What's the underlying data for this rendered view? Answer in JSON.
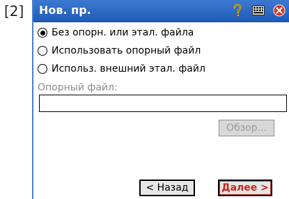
{
  "step_tag": "[2]",
  "window": {
    "title": "Нов. пр.",
    "icons": [
      "help-icon",
      "keyboard-icon",
      "close-icon"
    ]
  },
  "options": [
    {
      "label": "Без опорн. или этал. файла",
      "selected": true
    },
    {
      "label": "Использовать опорный файл",
      "selected": false
    },
    {
      "label": "Использ. внешний этал. файл",
      "selected": false
    }
  ],
  "reference_file": {
    "label": "Опорный файл:",
    "value": "",
    "browse_label": "Обзор..."
  },
  "nav": {
    "back_label": "< Назад",
    "next_label": "Далее >"
  },
  "colors": {
    "titlebar": "#2a69c4",
    "next_text": "#c8251a",
    "disabled_text": "#8c8c8c"
  }
}
